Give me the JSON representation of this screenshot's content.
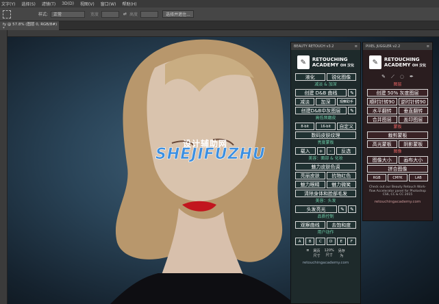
{
  "menu": [
    "文字(Y)",
    "选择(S)",
    "滤镜(T)",
    "3D(D)",
    "视图(V)",
    "窗口(W)",
    "帮助(H)"
  ],
  "options": {
    "style_label": "样式:",
    "style_value": "正常",
    "width_label": "宽度",
    "height_label": "高度",
    "select_mask": "选择并遮住..."
  },
  "doc_tab": "fy @ 57.8% (图层 0, RGB/8#) *",
  "watermark": {
    "cn": "设计辅助网",
    "en": "SHEJIFUZHU"
  },
  "panel1": {
    "header": "BEAUTY RETOUCH v3.2",
    "logo": {
      "line1": "RETOUCHING",
      "line2": "ACADEMY",
      "cn": "OH 汉化"
    },
    "row1": [
      "液化",
      "锐化图像"
    ],
    "sec_dodge": "减淡 & 加深",
    "row2": [
      "创建 D&B 曲线",
      "✎"
    ],
    "row3": [
      "减淡",
      "加深",
      "观察助手"
    ],
    "row4": [
      "创建D&B中灰图层",
      "✎"
    ],
    "sec_freq": "高低频磨皮",
    "row5": [
      "8-bit",
      "16-bit",
      "自定义"
    ],
    "row6": [
      "数码皮肤纹理"
    ],
    "sec_bright": "亮度蒙板",
    "row7": [
      "载入",
      "+",
      "-",
      "反选"
    ],
    "sec_face": "美容：面部 & 化妆",
    "row8": [
      "魅力皮肤色调"
    ],
    "row9": [
      "亮丽皮肤",
      "抗物红色"
    ],
    "row10": [
      "魅力眼睛",
      "魅力微笑"
    ],
    "row11": [
      "清除身体和脸部毛发"
    ],
    "sec_hair": "美容：头发",
    "row12": [
      "头发亮光",
      "✎",
      "✎"
    ],
    "sec_quality": "品质控制",
    "row13": [
      "观察曲线",
      "去饱和度"
    ],
    "sec_user": "用户动作",
    "letters": [
      "A",
      "B",
      "C",
      "D",
      "E",
      "F"
    ],
    "foot": [
      "网页\n尺寸",
      "120%\n尺寸",
      "另存\n为"
    ],
    "site": "retouchingacademy.com"
  },
  "panel2": {
    "header": "PIXEL JUGGLER v2.2",
    "logo": {
      "line1": "RETOUCHING",
      "line2": "ACADEMY",
      "cn": "OH 汉化"
    },
    "sec_layers": "图层",
    "row1": [
      "创建 50% 灰度图层"
    ],
    "row2": [
      "顺时针转90",
      "逆时针转90"
    ],
    "row3": [
      "水平翻转",
      "垂直翻转"
    ],
    "row4": [
      "合并图层",
      "盖印图层"
    ],
    "sec_mask": "蒙板",
    "row5": [
      "裁剪蒙板"
    ],
    "row6": [
      "高光蒙板",
      "阴影蒙板"
    ],
    "sec_image": "图像",
    "row7": [
      "图像大小",
      "画布大小"
    ],
    "row8": [
      "拼合图像"
    ],
    "row9": [
      "RGB",
      "CMYK",
      "LAB"
    ],
    "note": "Check out our Beauty Retouch Work-flow Accelerator panel for Photoshop CS6, CC & CC 2015",
    "site": "retouchingacademy.com"
  }
}
